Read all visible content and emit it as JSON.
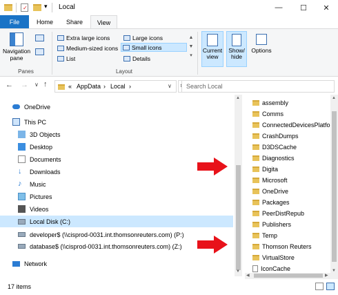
{
  "window": {
    "title": "Local",
    "minimize": "—",
    "maximize": "☐",
    "close": "✕"
  },
  "tabs": [
    {
      "label": "File"
    },
    {
      "label": "Home"
    },
    {
      "label": "Share"
    },
    {
      "label": "View"
    }
  ],
  "ribbon": {
    "panes": {
      "navigation_pane": "Navigation pane",
      "label": "Panes"
    },
    "layout": {
      "items": [
        "Extra large icons",
        "Large icons",
        "Medium-sized icons",
        "Small icons",
        "List",
        "Details"
      ],
      "label": "Layout"
    },
    "current_view": "Current view",
    "show_hide": "Show/ hide",
    "options": "Options"
  },
  "address": {
    "path": [
      "«",
      "AppData",
      "›",
      "Local",
      "›"
    ],
    "search_placeholder": "Search Local"
  },
  "nav": [
    {
      "label": "OneDrive",
      "icon": "cloud-icon"
    },
    {
      "label": "This PC",
      "icon": "computer-icon"
    },
    {
      "label": "3D Objects",
      "icon": "cube-icon"
    },
    {
      "label": "Desktop",
      "icon": "desktop-icon"
    },
    {
      "label": "Documents",
      "icon": "documents-icon"
    },
    {
      "label": "Downloads",
      "icon": "download-icon"
    },
    {
      "label": "Music",
      "icon": "music-icon"
    },
    {
      "label": "Pictures",
      "icon": "pictures-icon"
    },
    {
      "label": "Videos",
      "icon": "videos-icon"
    },
    {
      "label": "Local Disk (C:)",
      "icon": "drive-icon"
    },
    {
      "label": "developer$ (\\\\cisprod-0031.int.thomsonreuters.com) (P:)",
      "icon": "network-drive-icon"
    },
    {
      "label": "database$ (\\\\cisprod-0031.int.thomsonreuters.com) (Z:)",
      "icon": "network-drive-icon"
    },
    {
      "label": "Network",
      "icon": "network-icon"
    }
  ],
  "files": [
    "assembly",
    "Comms",
    "ConnectedDevicesPlatfo",
    "CrashDumps",
    "D3DSCache",
    "Diagnostics",
    "Digita",
    "Microsoft",
    "OneDrive",
    "Packages",
    "PeerDistRepub",
    "Publishers",
    "Temp",
    "Thomson Reuters",
    "VirtualStore",
    "IconCache"
  ],
  "status": {
    "count": "17 items"
  },
  "colors": {
    "accent": "#1a73c6",
    "arrow": "#e8121a",
    "selected": "#cce8ff",
    "folder": "#e8c35a"
  }
}
